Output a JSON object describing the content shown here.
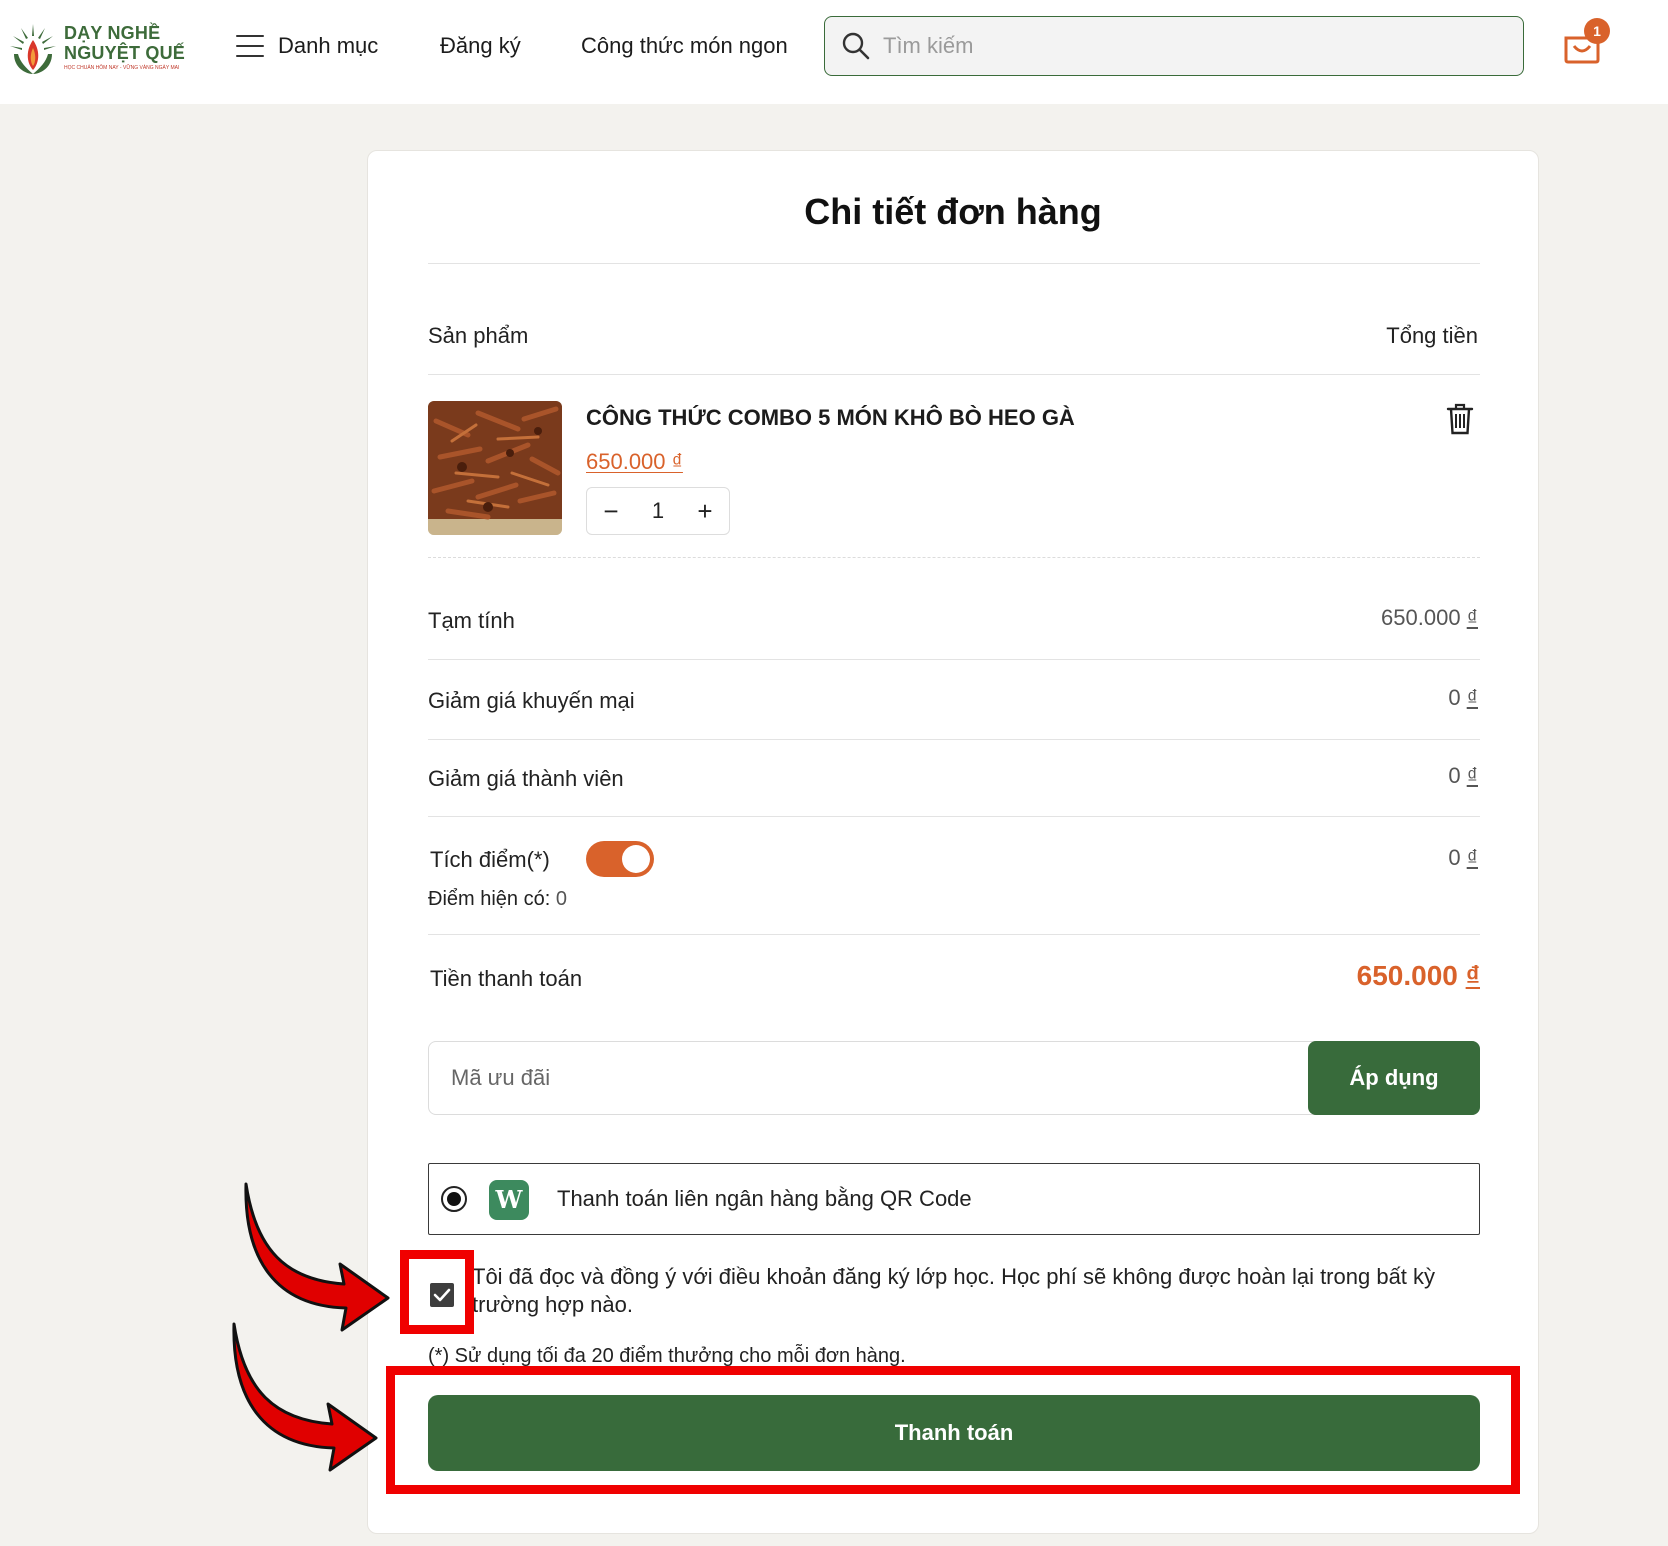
{
  "header": {
    "logo": {
      "line1": "DẠY NGHỀ",
      "line2": "NGUYỆT QUẾ",
      "tagline": "HỌC CHUẨN HÔM NAY - VỮNG VÀNG NGÀY MAI"
    },
    "nav": {
      "menu_label": "Danh mục",
      "register_label": "Đăng ký",
      "recipes_label": "Công thức món ngon"
    },
    "search": {
      "placeholder": "Tìm kiếm"
    },
    "cart": {
      "count": "1"
    }
  },
  "order": {
    "title": "Chi tiết đơn hàng",
    "col_product": "Sản phẩm",
    "col_total": "Tổng tiền",
    "item": {
      "name": "CÔNG THỨC COMBO 5 MÓN KHÔ BÒ HEO GÀ",
      "price": "650.000 ₫",
      "quantity": "1",
      "minus": "−",
      "plus": "+"
    },
    "subtotal": {
      "label": "Tạm tính",
      "value": "650.000",
      "currency": "₫"
    },
    "promo_discount": {
      "label": "Giảm giá khuyến mại",
      "value": "0",
      "currency": "₫"
    },
    "member_discount": {
      "label": "Giảm giá thành viên",
      "value": "0",
      "currency": "₫"
    },
    "points": {
      "label": "Tích điểm(*)",
      "value": "0",
      "currency": "₫",
      "toggle_on": true,
      "current_label": "Điểm hiện có:",
      "current_value": "0"
    },
    "total": {
      "label": "Tiền thanh toán",
      "value": "650.000",
      "currency": "₫"
    },
    "coupon": {
      "placeholder": "Mã ưu đãi",
      "apply_label": "Áp dụng"
    },
    "payment": {
      "method_label": "Thanh toán liên ngân hàng bằng QR Code",
      "logo_letter": "W",
      "selected": true
    },
    "agree": {
      "checked": true,
      "text": "Tôi đã đọc và đồng ý với điều khoản đăng ký lớp học. Học phí sẽ không được hoàn lại trong bất kỳ trường hợp nào."
    },
    "note": "(*) Sử dụng tối đa 20 điểm thưởng cho mỗi đơn hàng.",
    "checkout_label": "Thanh toán"
  },
  "colors": {
    "brand_green": "#386b3b",
    "accent_orange": "#d9622b",
    "highlight_red": "#f00000"
  }
}
